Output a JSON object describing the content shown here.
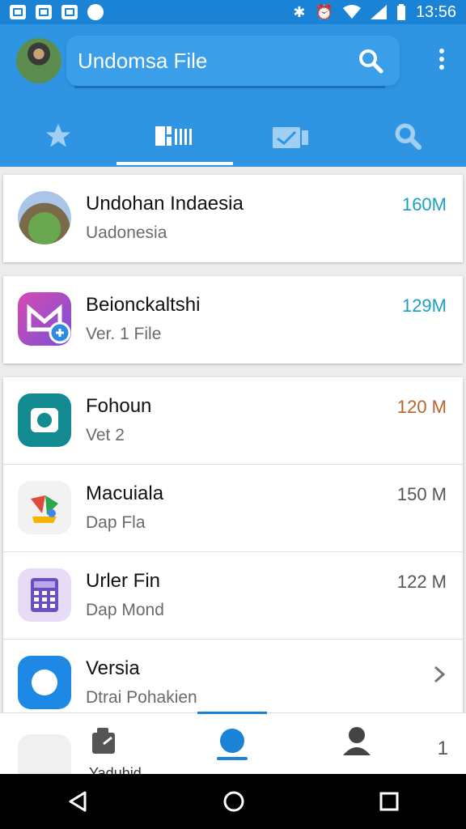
{
  "status_bar": {
    "time": "13:56"
  },
  "app_bar": {
    "title": "Undomsa File",
    "tabs": [
      {
        "icon": "star-icon",
        "active": false
      },
      {
        "icon": "grid-list-icon",
        "active": true
      },
      {
        "icon": "media-icon",
        "active": false
      },
      {
        "icon": "search-icon",
        "active": false
      }
    ]
  },
  "list": [
    {
      "title": "Undohan Indaesia",
      "subtitle": "Uadonesia",
      "size": "160M",
      "size_color": "#1a9fc4",
      "icon": "photo-avatar-icon"
    },
    {
      "title": "Beionckaltshi",
      "subtitle": "Ver. 1 File",
      "size": "129M",
      "size_color": "#1a9fc4",
      "icon": "messenger-icon"
    },
    {
      "title": "Fohoun",
      "subtitle": "Vet 2",
      "size": "120 M",
      "size_color": "#b5652b",
      "icon": "camera-icon"
    },
    {
      "title": "Macuiala",
      "subtitle": "Dap Fla",
      "size": "150 M",
      "size_color": "#555555",
      "icon": "colorful-app-icon"
    },
    {
      "title": "Urler Fin",
      "subtitle": "Dap Mond",
      "size": "122 M",
      "size_color": "#555555",
      "icon": "calculator-icon"
    },
    {
      "title": "Versia",
      "subtitle": "Dtrai Pohakien",
      "size": "",
      "size_color": "#555555",
      "icon": "circle-app-icon"
    }
  ],
  "bottom_nav": {
    "peek_text": "Yaduhid",
    "count": "1"
  },
  "colors": {
    "primary": "#2f95e3",
    "status": "#1a83d6"
  }
}
